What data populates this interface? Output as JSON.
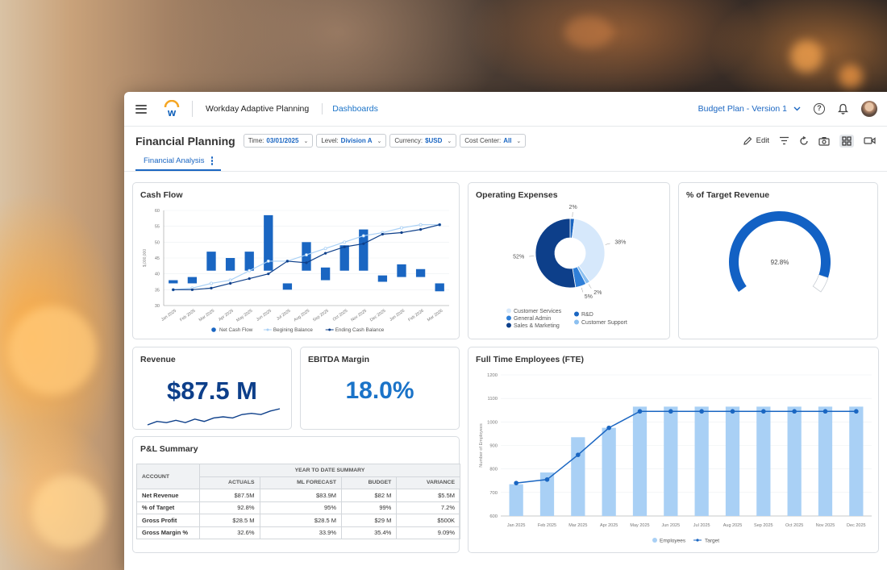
{
  "app": {
    "name": "Workday Adaptive Planning",
    "nav": "Dashboards",
    "plan": "Budget Plan - Version 1"
  },
  "colors": {
    "primary": "#1a66c2",
    "dark": "#0d3f8a",
    "light": "#a9d0f5",
    "accent": "#1a73c8"
  },
  "icons": [
    "menu-icon",
    "workday-logo",
    "chevron-down-icon",
    "help-icon",
    "bell-icon",
    "avatar",
    "pencil-icon",
    "filter-icon",
    "refresh-icon",
    "camera-icon",
    "grid-icon",
    "video-icon"
  ],
  "page": {
    "title": "Financial Planning",
    "filters": [
      {
        "label": "Time:",
        "value": "03/01/2025"
      },
      {
        "label": "Level:",
        "value": "Division A"
      },
      {
        "label": "Currency:",
        "value": "$USD"
      },
      {
        "label": "Cost Center:",
        "value": "All"
      }
    ],
    "edit_label": "Edit",
    "tab": "Financial Analysis"
  },
  "cards": {
    "cashflow": {
      "title": "Cash Flow"
    },
    "opex": {
      "title": "Operating Expenses"
    },
    "target": {
      "title": "% of Target Revenue",
      "value_label": "92.8%"
    },
    "revenue": {
      "title": "Revenue",
      "value": "$87.5 M"
    },
    "ebitda": {
      "title": "EBITDA Margin",
      "value": "18.0%"
    },
    "fte": {
      "title": "Full Time Employees (FTE)"
    },
    "pl": {
      "title": "P&L Summary",
      "group_header": "YEAR TO DATE SUMMARY",
      "account_header": "ACCOUNT",
      "columns": [
        "ACTUALS",
        "ML FORECAST",
        "BUDGET",
        "VARIANCE"
      ],
      "rows": [
        {
          "account": "Net Revenue",
          "cells": [
            "$87.5M",
            "$83.9M",
            "$82 M",
            "$5.5M"
          ]
        },
        {
          "account": "% of Target",
          "cells": [
            "92.8%",
            "95%",
            "99%",
            "7.2%"
          ]
        },
        {
          "account": "Gross Profit",
          "cells": [
            "$28.5 M",
            "$28.5 M",
            "$29 M",
            "$500K"
          ]
        },
        {
          "account": "Gross Margin %",
          "cells": [
            "32.6%",
            "33.9%",
            "35.4%",
            "9.09%"
          ]
        }
      ]
    }
  },
  "chart_data": [
    {
      "id": "cashflow",
      "type": "bar",
      "title": "Cash Flow",
      "ylabel": "$,000,000",
      "ylim": [
        30,
        60
      ],
      "yticks": [
        30,
        35,
        40,
        45,
        50,
        55,
        60
      ],
      "categories": [
        "Jan 2025",
        "Feb 2025",
        "Mar 2025",
        "Apr 2025",
        "May 2025",
        "Jun 2025",
        "Jul 2025",
        "Aug 2025",
        "Sep 2025",
        "Oct 2025",
        "Nov 2025",
        "Dec 2025",
        "Jan 2026",
        "Feb 2026",
        "Mar 2026"
      ],
      "series": [
        {
          "name": "Net Cash Flow",
          "kind": "bar",
          "values": [
            38,
            39,
            47,
            45,
            47,
            58.5,
            37,
            50,
            42,
            49,
            54,
            39.5,
            43,
            41.5,
            37
          ]
        },
        {
          "name": "Begining Balance",
          "kind": "line",
          "values": [
            35,
            35.5,
            37,
            38,
            41,
            44,
            44,
            46,
            48,
            50,
            52,
            53,
            54.5,
            55.5,
            55.5
          ]
        },
        {
          "name": "Ending Cash Balance",
          "kind": "line",
          "values": [
            35,
            35,
            35.5,
            37,
            38.5,
            40,
            44,
            43.5,
            46.5,
            48.5,
            49.5,
            52.5,
            53,
            54,
            55.5
          ]
        }
      ],
      "legend_position": "bottom"
    },
    {
      "id": "opex",
      "type": "pie",
      "title": "Operating Expenses",
      "slices": [
        {
          "name": "R&D",
          "value": 2,
          "label": "2%"
        },
        {
          "name": "Customer Services",
          "value": 38,
          "label": "38%"
        },
        {
          "name": "Customer Support",
          "value": 2,
          "label": "2%"
        },
        {
          "name": "General Admin",
          "value": 5,
          "label": "5%"
        },
        {
          "name": "Sales & Marketing",
          "value": 52,
          "label": "52%"
        }
      ],
      "legend": [
        "Customer Services",
        "R&D",
        "General Admin",
        "Customer Support",
        "Sales & Marketing"
      ],
      "legend_position": "bottom"
    },
    {
      "id": "target",
      "type": "gauge",
      "title": "% of Target Revenue",
      "value": 92.8,
      "max": 100
    },
    {
      "id": "revenue_spark",
      "type": "line",
      "values": [
        21,
        24,
        23,
        25,
        23,
        26,
        24,
        27,
        28,
        27,
        30,
        31,
        30,
        33,
        35
      ]
    },
    {
      "id": "fte",
      "type": "bar",
      "title": "Full Time Employees (FTE)",
      "ylabel": "Number of Employees",
      "ylim": [
        600,
        1200
      ],
      "yticks": [
        600,
        700,
        800,
        900,
        1000,
        1100,
        1200
      ],
      "categories": [
        "Jan 2025",
        "Feb 2025",
        "Mar 2025",
        "Apr 2025",
        "May 2025",
        "Jun 2025",
        "Jul 2025",
        "Aug 2025",
        "Sep 2025",
        "Oct 2025",
        "Nov 2025",
        "Dec 2025"
      ],
      "series": [
        {
          "name": "Employees",
          "kind": "bar",
          "values": [
            735,
            785,
            935,
            975,
            1065,
            1065,
            1065,
            1065,
            1065,
            1065,
            1065,
            1065
          ]
        },
        {
          "name": "Target",
          "kind": "line",
          "values": [
            740,
            755,
            860,
            975,
            1045,
            1045,
            1045,
            1045,
            1045,
            1045,
            1045,
            1045
          ]
        }
      ],
      "legend_position": "bottom"
    }
  ]
}
